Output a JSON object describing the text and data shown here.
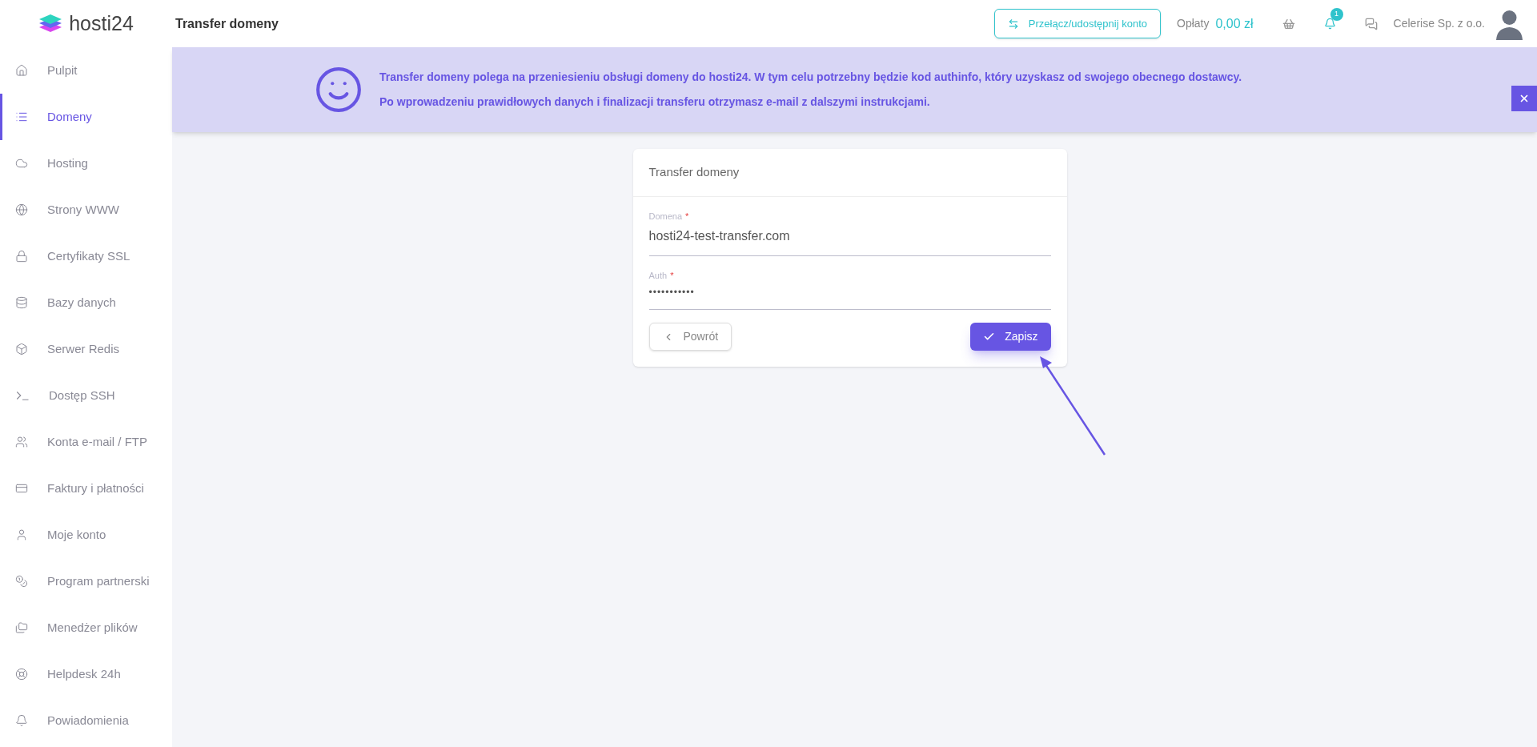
{
  "header": {
    "logo": "hosti24",
    "page_title": "Transfer domeny",
    "switch_button": "Przełącz/udostępnij konto",
    "fees_label": "Opłaty",
    "fees_value": "0,00 zł",
    "notification_count": "1",
    "company": "Celerise Sp. z o.o."
  },
  "sidebar": {
    "items": [
      {
        "label": "Pulpit",
        "selected": false
      },
      {
        "label": "Domeny",
        "selected": true
      },
      {
        "label": "Hosting",
        "selected": false
      },
      {
        "label": "Strony WWW",
        "selected": false
      },
      {
        "label": "Certyfikaty SSL",
        "selected": false
      },
      {
        "label": "Bazy danych",
        "selected": false
      },
      {
        "label": "Serwer Redis",
        "selected": false
      },
      {
        "label": "Dostęp SSH",
        "selected": false
      },
      {
        "label": "Konta e-mail / FTP",
        "selected": false
      },
      {
        "label": "Faktury i płatności",
        "selected": false
      },
      {
        "label": "Moje konto",
        "selected": false
      },
      {
        "label": "Program partnerski",
        "selected": false
      },
      {
        "label": "Menedżer plików",
        "selected": false
      },
      {
        "label": "Helpdesk 24h",
        "selected": false
      },
      {
        "label": "Powiadomienia",
        "selected": false
      }
    ]
  },
  "banner": {
    "lines": [
      "Transfer domeny polega na przeniesieniu obsługi domeny do hosti24. W tym celu potrzebny będzie kod authinfo, który uzyskasz od swojego obecnego dostawcy.",
      "Po wprowadzeniu prawidłowych danych i finalizacji transferu otrzymasz e-mail z dalszymi instrukcjami."
    ]
  },
  "form": {
    "title": "Transfer domeny",
    "fields": [
      {
        "label": "Domena",
        "required_mark": "*",
        "value": "hosti24-test-transfer.com",
        "kind": "text"
      },
      {
        "label": "Auth",
        "required_mark": "*",
        "value": "•••••••••••",
        "kind": "password"
      }
    ],
    "back_button": "Powrót",
    "save_button": "Zapisz"
  }
}
